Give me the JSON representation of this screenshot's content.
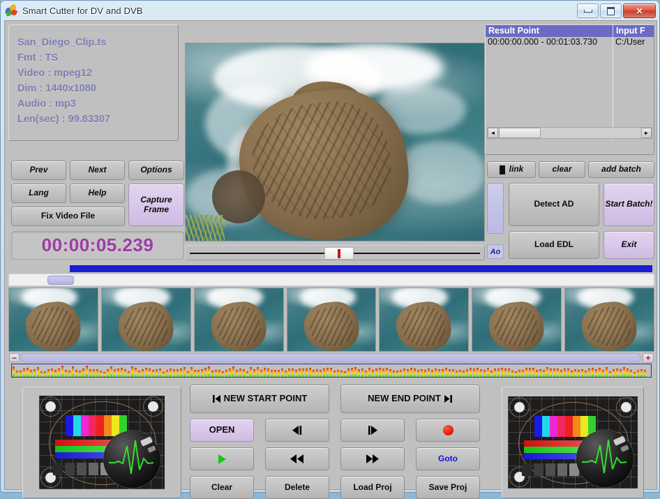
{
  "window": {
    "title": "Smart Cutter for DV and DVB",
    "icon": "butterfly-icon",
    "controls": {
      "minimize": "minimize",
      "maximize": "maximize",
      "close": "close"
    }
  },
  "info_panel": {
    "filename": "San_Diego_Clip.ts",
    "format": "Fmt : TS",
    "video": "Video : mpeg12",
    "dimensions": "Dim : 1440x1080",
    "audio": "Audio : mp3",
    "length": "Len(sec) : 99.83307",
    "text_color": "#7f7fb4"
  },
  "left_buttons": {
    "prev": "Prev",
    "next": "Next",
    "options": "Options",
    "lang": "Lang",
    "help": "Help",
    "capture_frame": "Capture Frame",
    "fix_video_file": "Fix Video File"
  },
  "timecode": {
    "value": "00:00:05.239",
    "color": "#9b3ca5"
  },
  "result_list": {
    "columns": [
      "Result Point",
      "Input F"
    ],
    "header_color": "#6b6bc6",
    "rows": [
      {
        "result_point": "00:00:00.000 - 00:01:03.730",
        "input_file": "C:/User"
      }
    ],
    "scroll_left": "◄",
    "scroll_right": "►"
  },
  "right_buttons": {
    "link": "link",
    "clear": "clear",
    "add_batch": "add batch",
    "detect_ad": "Detect AD",
    "load_edl": "Load EDL",
    "start_batch": "Start Batch!",
    "exit": "Exit",
    "ao_label": "Ao"
  },
  "bottom_controls": {
    "new_start_point": "NEW START POINT",
    "new_end_point": "NEW END POINT",
    "open": "OPEN",
    "step_back": "step-back-icon",
    "step_forward": "step-forward-icon",
    "record": "record-icon",
    "play": "play-icon",
    "rewind": "rewind-icon",
    "fast_forward": "fast-forward-icon",
    "goto": "Goto",
    "clear": "Clear",
    "delete": "Delete",
    "load_proj": "Load Proj",
    "save_proj": "Save Proj",
    "goto_color": "#1414d2",
    "record_color": "#e01505",
    "play_color": "#19c419"
  },
  "audio_strip": {
    "zoom_out": "−",
    "zoom_in": "+",
    "zoom_button_color": "#d01010"
  },
  "progress": {
    "fill_color": "#1b1bd6",
    "percent": 90
  },
  "thumbnails_count": 7
}
